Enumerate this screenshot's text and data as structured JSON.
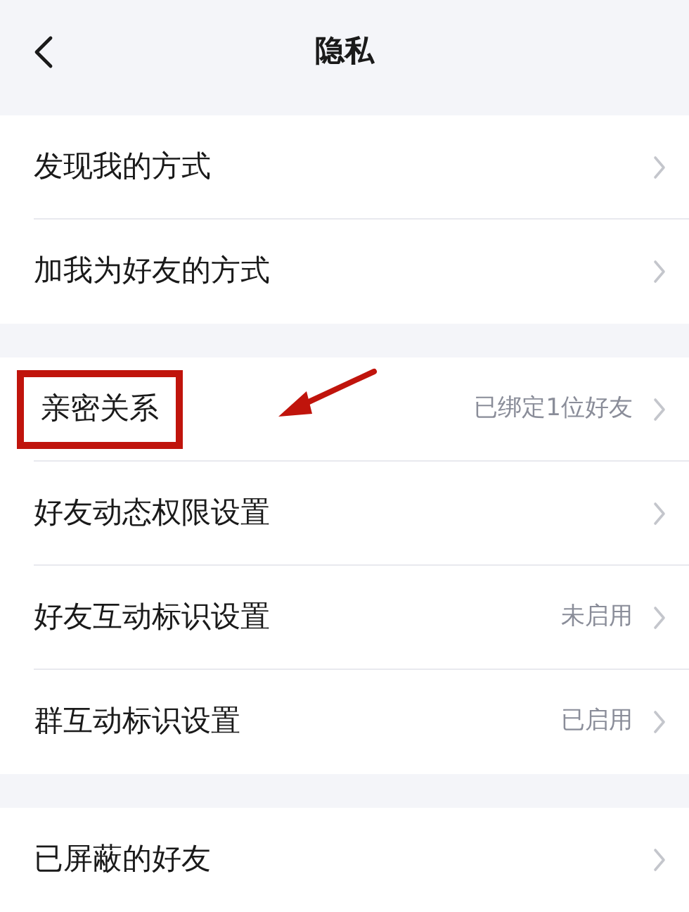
{
  "nav": {
    "title": "隐私"
  },
  "groups": [
    {
      "rows": [
        {
          "label": "发现我的方式",
          "highlighted": false
        },
        {
          "label": "加我为好友的方式",
          "highlighted": false
        }
      ]
    },
    {
      "rows": [
        {
          "label": "亲密关系",
          "value": "已绑定1位好友",
          "highlighted": true
        },
        {
          "label": "好友动态权限设置",
          "highlighted": false
        },
        {
          "label": "好友互动标识设置",
          "value": "未启用",
          "highlighted": false
        },
        {
          "label": "群互动标识设置",
          "value": "已启用",
          "highlighted": false
        }
      ]
    },
    {
      "rows": [
        {
          "label": "已屏蔽的好友",
          "highlighted": false
        }
      ]
    }
  ]
}
